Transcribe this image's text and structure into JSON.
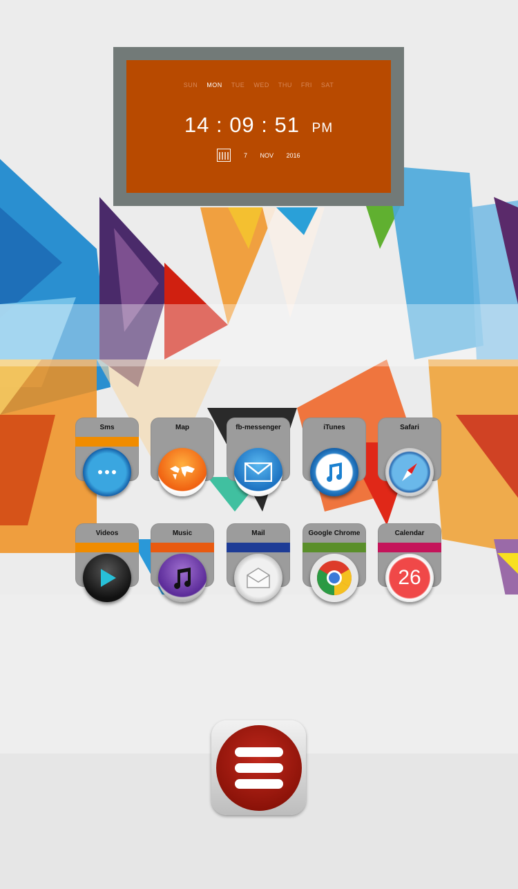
{
  "clock": {
    "weekdays": [
      "SUN",
      "MON",
      "TUE",
      "WED",
      "THU",
      "FRI",
      "SAT"
    ],
    "active_day": "MON",
    "hours": "14",
    "minutes": "09",
    "seconds": "51",
    "ampm": "PM",
    "date_day": "7",
    "date_month": "NOV",
    "date_year": "2016"
  },
  "apps": [
    {
      "label": "Sms",
      "stripe": "#f08c00",
      "icon": "chat-bubble-icon"
    },
    {
      "label": "Map",
      "stripe": "#9c9c9c",
      "icon": "world-map-icon"
    },
    {
      "label": "fb-messenger",
      "stripe": "#9c9c9c",
      "icon": "envelope-icon"
    },
    {
      "label": "iTunes",
      "stripe": "#9c9c9c",
      "icon": "music-note-icon"
    },
    {
      "label": "Safari",
      "stripe": "#9c9c9c",
      "icon": "compass-icon"
    },
    {
      "label": "Videos",
      "stripe": "#f08c00",
      "icon": "play-icon"
    },
    {
      "label": "Music",
      "stripe": "#e85a10",
      "icon": "music-notes-icon"
    },
    {
      "label": "Mail",
      "stripe": "#1e3c96",
      "icon": "open-envelope-icon"
    },
    {
      "label": "Google Chrome",
      "stripe": "#5a8f2a",
      "icon": "chrome-icon"
    },
    {
      "label": "Calendar",
      "stripe": "#c4145a",
      "icon": "calendar-icon",
      "badge_text": "26"
    }
  ],
  "menu_button": {
    "icon": "hamburger-menu-icon"
  }
}
